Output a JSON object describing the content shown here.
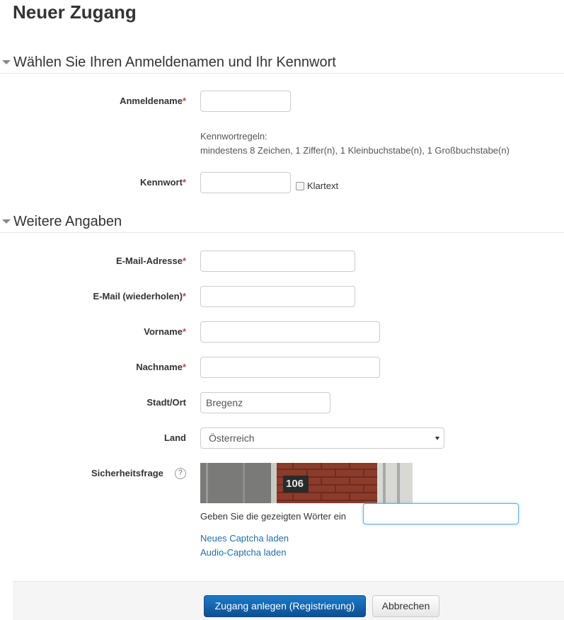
{
  "page": {
    "title": "Neuer Zugang"
  },
  "section_login": {
    "legend": "Wählen Sie Ihren Anmeldenamen und Ihr Kennwort",
    "username_label": "Anmeldename",
    "password_rules_title": "Kennwortregeln:",
    "password_rules": "mindestens 8 Zeichen, 1 Ziffer(n), 1 Kleinbuchstabe(n), 1 Großbuchstabe(n)",
    "password_label": "Kennwort",
    "unmask_label": "Klartext",
    "required_marker": "*"
  },
  "section_more": {
    "legend": "Weitere Angaben",
    "email_label": "E-Mail-Adresse",
    "email2_label": "E-Mail (wiederholen)",
    "firstname_label": "Vorname",
    "lastname_label": "Nachname",
    "city_label": "Stadt/Ort",
    "city_value": "Bregenz",
    "country_label": "Land",
    "country_value": "Österreich",
    "security_label": "Sicherheitsfrage",
    "help_icon": "?",
    "captcha_image_text": "106",
    "captcha_prompt": "Geben Sie die gezeigten Wörter ein",
    "new_captcha_link": "Neues Captcha laden",
    "audio_captcha_link": "Audio-Captcha laden"
  },
  "footer": {
    "submit_label": "Zugang anlegen (Registrierung)",
    "cancel_label": "Abbrechen"
  },
  "icons": {
    "section_toggle": "triangle-down-icon",
    "help": "question-circle-icon",
    "select_caret": "caret-down-icon"
  },
  "colors": {
    "required": "#b94a48",
    "link": "#1f6fa8",
    "primary_button": "#0d4f93"
  }
}
